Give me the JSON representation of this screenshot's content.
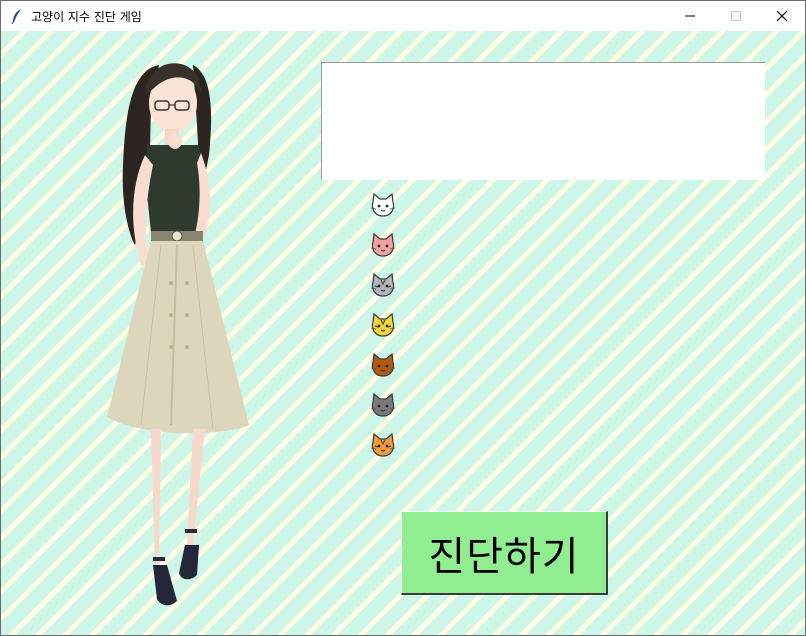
{
  "window": {
    "title": "고양이 지수 진단 게임",
    "icons": {
      "app": "feather-icon",
      "minimize": "minimize-icon",
      "maximize": "maximize-icon",
      "close": "close-icon"
    }
  },
  "colors": {
    "stripe_base": "#cdf6e8",
    "stripe_light": "#fdfee2",
    "button_green": "#90ee90",
    "result_bg": "#ffffff"
  },
  "result": {
    "text": ""
  },
  "cats": [
    {
      "icon": "white-cat-icon",
      "color": "#ffffff"
    },
    {
      "icon": "pink-cat-icon",
      "color": "#f4a1a1"
    },
    {
      "icon": "gray-tabby-cat-icon",
      "color": "#b3b3bd"
    },
    {
      "icon": "yellow-tabby-cat-icon",
      "color": "#f7d53a"
    },
    {
      "icon": "brown-cat-icon",
      "color": "#b35a12"
    },
    {
      "icon": "dark-gray-cat-icon",
      "color": "#7a7a7a"
    },
    {
      "icon": "orange-tiger-cat-icon",
      "color": "#f39a3c"
    }
  ],
  "diagnose_button": {
    "label": "진단하기"
  },
  "character": {
    "icon": "anime-girl-illustration"
  }
}
